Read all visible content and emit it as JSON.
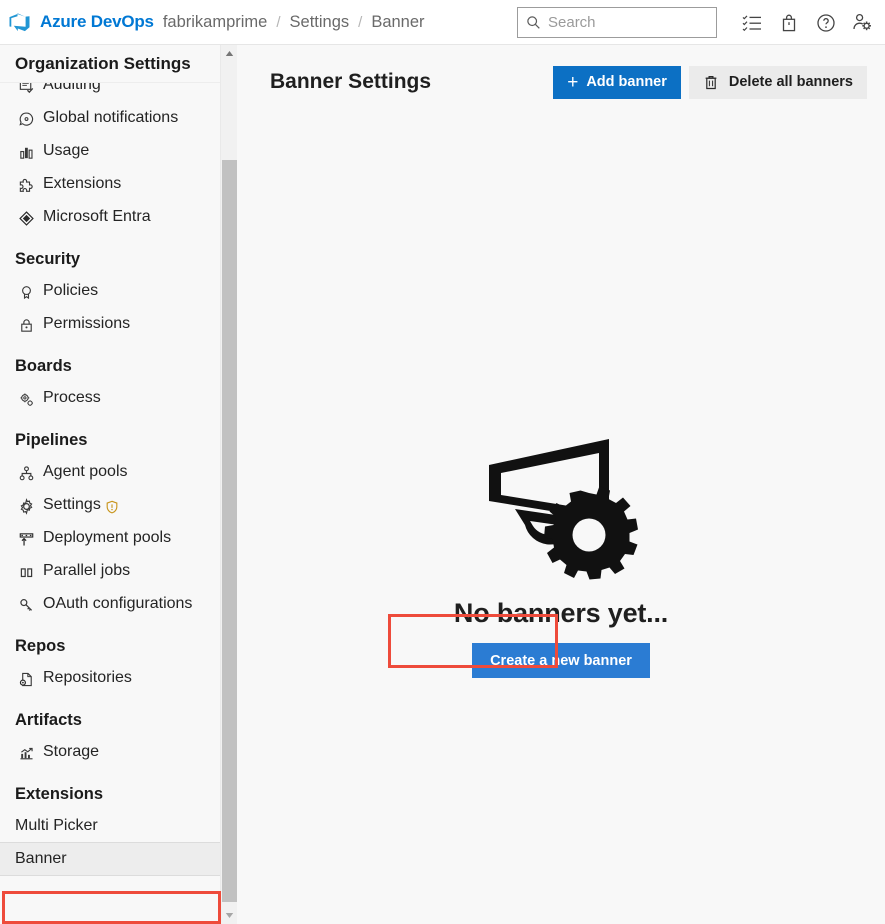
{
  "topbar": {
    "logo_icon": "azure-devops-logo-icon",
    "brand": "Azure DevOps",
    "breadcrumbs": [
      {
        "label": "fabrikamprime"
      },
      {
        "label": "Settings"
      },
      {
        "label": "Banner"
      }
    ],
    "separator": "/",
    "search": {
      "placeholder": "Search",
      "value": "",
      "icon": "search-icon"
    },
    "actions": [
      {
        "name": "tasks-checklist-icon",
        "title": "Tasks"
      },
      {
        "name": "marketplace-bag-icon",
        "title": "Marketplace"
      },
      {
        "name": "help-question-icon",
        "title": "Help"
      },
      {
        "name": "user-settings-icon",
        "title": "User settings"
      }
    ]
  },
  "sidebar": {
    "header": "Organization Settings",
    "items": [
      {
        "type": "item",
        "label": "Auditing",
        "icon": "auditing-icon",
        "clipped": true
      },
      {
        "type": "item",
        "label": "Global notifications",
        "icon": "notifications-icon"
      },
      {
        "type": "item",
        "label": "Usage",
        "icon": "usage-chart-icon"
      },
      {
        "type": "item",
        "label": "Extensions",
        "icon": "extensions-puzzle-icon"
      },
      {
        "type": "item",
        "label": "Microsoft Entra",
        "icon": "microsoft-entra-icon"
      },
      {
        "type": "group",
        "label": "Security"
      },
      {
        "type": "item",
        "label": "Policies",
        "icon": "policies-ribbon-icon"
      },
      {
        "type": "item",
        "label": "Permissions",
        "icon": "permissions-lock-icon"
      },
      {
        "type": "group",
        "label": "Boards"
      },
      {
        "type": "item",
        "label": "Process",
        "icon": "process-gears-icon"
      },
      {
        "type": "group",
        "label": "Pipelines"
      },
      {
        "type": "item",
        "label": "Agent pools",
        "icon": "agent-pools-icon"
      },
      {
        "type": "item",
        "label": "Settings",
        "icon": "settings-gear-icon",
        "badge": "warning-shield-icon"
      },
      {
        "type": "item",
        "label": "Deployment pools",
        "icon": "deployment-pools-icon"
      },
      {
        "type": "item",
        "label": "Parallel jobs",
        "icon": "parallel-jobs-icon"
      },
      {
        "type": "item",
        "label": "OAuth configurations",
        "icon": "oauth-key-icon"
      },
      {
        "type": "group",
        "label": "Repos"
      },
      {
        "type": "item",
        "label": "Repositories",
        "icon": "repositories-icon"
      },
      {
        "type": "group",
        "label": "Artifacts"
      },
      {
        "type": "item",
        "label": "Storage",
        "icon": "storage-chart-icon"
      },
      {
        "type": "group",
        "label": "Extensions"
      },
      {
        "type": "item",
        "label": "Multi Picker",
        "icon": null
      },
      {
        "type": "item",
        "label": "Banner",
        "icon": null,
        "selected": true,
        "highlighted": true
      }
    ]
  },
  "main": {
    "title": "Banner Settings",
    "add_banner_label": "Add banner",
    "add_banner_plus": "+",
    "delete_all_label": "Delete all banners",
    "delete_icon": "trash-icon",
    "empty": {
      "illustration": "megaphone-gear-icon",
      "title": "No banners yet...",
      "cta_label": "Create a new banner",
      "cta_highlighted": true
    }
  },
  "colors": {
    "accent_blue": "#0078d4",
    "button_blue": "#0c70c4",
    "cta_blue": "#2b7cd3",
    "highlight_red": "#ee4b3b",
    "sidebar_bg": "#f8f8f8",
    "selected_bg": "#ededed"
  },
  "scrollbar": {
    "orientation": "vertical",
    "thumb_position": "bottom"
  }
}
